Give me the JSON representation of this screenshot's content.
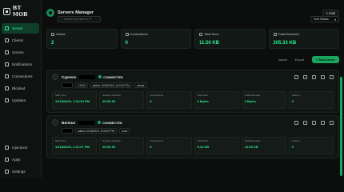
{
  "brand": {
    "name": "BT MOB"
  },
  "sidebar": {
    "items": [
      {
        "label": "Server",
        "active": true
      },
      {
        "label": "Clients"
      },
      {
        "label": "Screen"
      },
      {
        "label": "Notifications"
      },
      {
        "label": "Connections"
      },
      {
        "label": "Blocked"
      },
      {
        "label": "Updates"
      }
    ],
    "bottom": [
      {
        "label": "Injections"
      },
      {
        "label": "Apps"
      },
      {
        "label": "Settings"
      }
    ]
  },
  "header": {
    "title": "Servers Manager",
    "user_badge": "1 total"
  },
  "search": {
    "placeholder": "Search by name or IP"
  },
  "filter": {
    "value": "Sort Status"
  },
  "stats": [
    {
      "label": "Online",
      "value": "2"
    },
    {
      "label": "Connections",
      "value": "0"
    },
    {
      "label": "Total Sent",
      "value": "11.50 KB"
    },
    {
      "label": "Total Received",
      "value": "205.33 KB"
    }
  ],
  "actions": {
    "import": "Import",
    "export": "Export",
    "add": "+ Add Server"
  },
  "servers": [
    {
      "name": "Cypress",
      "status": "CONNECTED",
      "tags": [
        "",
        ":13103",
        "added: 10/18/2023, 11:23:47 PM",
        "private"
      ],
      "metrics": [
        {
          "l": "Start Time",
          "v": "11/18/2023, 1:13:54 PM"
        },
        {
          "l": "Session Duration",
          "v": "00:00:00"
        },
        {
          "l": "Connections",
          "v": "0"
        },
        {
          "l": "Total Sent",
          "v": "0 Bytes"
        },
        {
          "l": "Total Received",
          "v": "0 Bytes"
        },
        {
          "l": "Latency",
          "v": "0"
        }
      ]
    },
    {
      "name": "Bermus",
      "status": "CONNECTED",
      "tags": [
        "",
        "added: 10/18/2023, 11:09:57 PM",
        "none"
      ],
      "metrics": [
        {
          "l": "Start Time",
          "v": "11/18/2023, 1:11:27 PM"
        },
        {
          "l": "Session Duration",
          "v": "00:00:00"
        },
        {
          "l": "Connections",
          "v": "0"
        },
        {
          "l": "Total Sent",
          "v": "5.19 KB"
        },
        {
          "l": "Total Received",
          "v": "14.08 KB"
        },
        {
          "l": "Latency",
          "v": "0"
        }
      ]
    }
  ]
}
